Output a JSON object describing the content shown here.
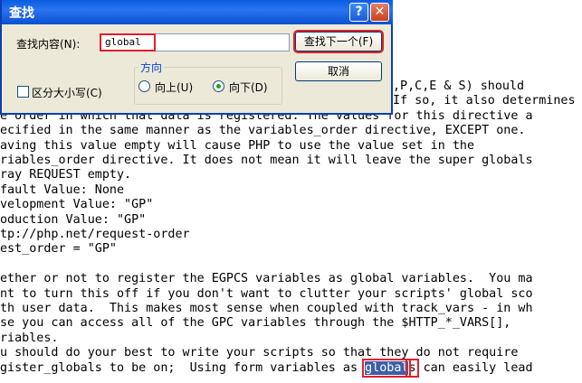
{
  "dialog": {
    "title": "查找",
    "help_glyph": "?",
    "close_glyph": "✕",
    "find_label": "查找内容(N):",
    "find_value": "global",
    "find_next_label": "查找下一个(F)",
    "cancel_label": "取消",
    "direction_legend": "方向",
    "direction_up_label": "向上(U)",
    "direction_down_label": "向下(D)",
    "direction_selected": "down",
    "match_case_label": "区分大小写(C)",
    "match_case_checked": false
  },
  "document": {
    "lines": [
      "",
      "",
      "",
      "",
      "",
      ",P,C,E & S) should",
      "If so, it also determines",
      "e order in which that data is registered. The values for this directive a",
      "ecified in the same manner as the variables_order directive, EXCEPT one.",
      "aving this value empty will cause PHP to use the value set in the",
      "riables_order directive. It does not mean it will leave the super globals",
      "ray REQUEST empty.",
      "fault Value: None",
      "velopment Value: \"GP\"",
      "oduction Value: \"GP\"",
      "tp://php.net/request-order",
      "est_order = \"GP\"",
      "",
      "ether or not to register the EGPCS variables as global variables.  You ma",
      "nt to turn this off if you don't want to clutter your scripts' global sco",
      "th user data.  This makes most sense when coupled with track_vars - in wh",
      "se you can access all of the GPC variables through the $HTTP_*_VARS[],",
      "riables.",
      "u should do your best to write your scripts so that they do not require"
    ],
    "last_line_before": "gister_globals to be on;  Using form variables as ",
    "last_line_match": "global",
    "last_line_match_tail": "s",
    "last_line_after": " can easily lead"
  }
}
